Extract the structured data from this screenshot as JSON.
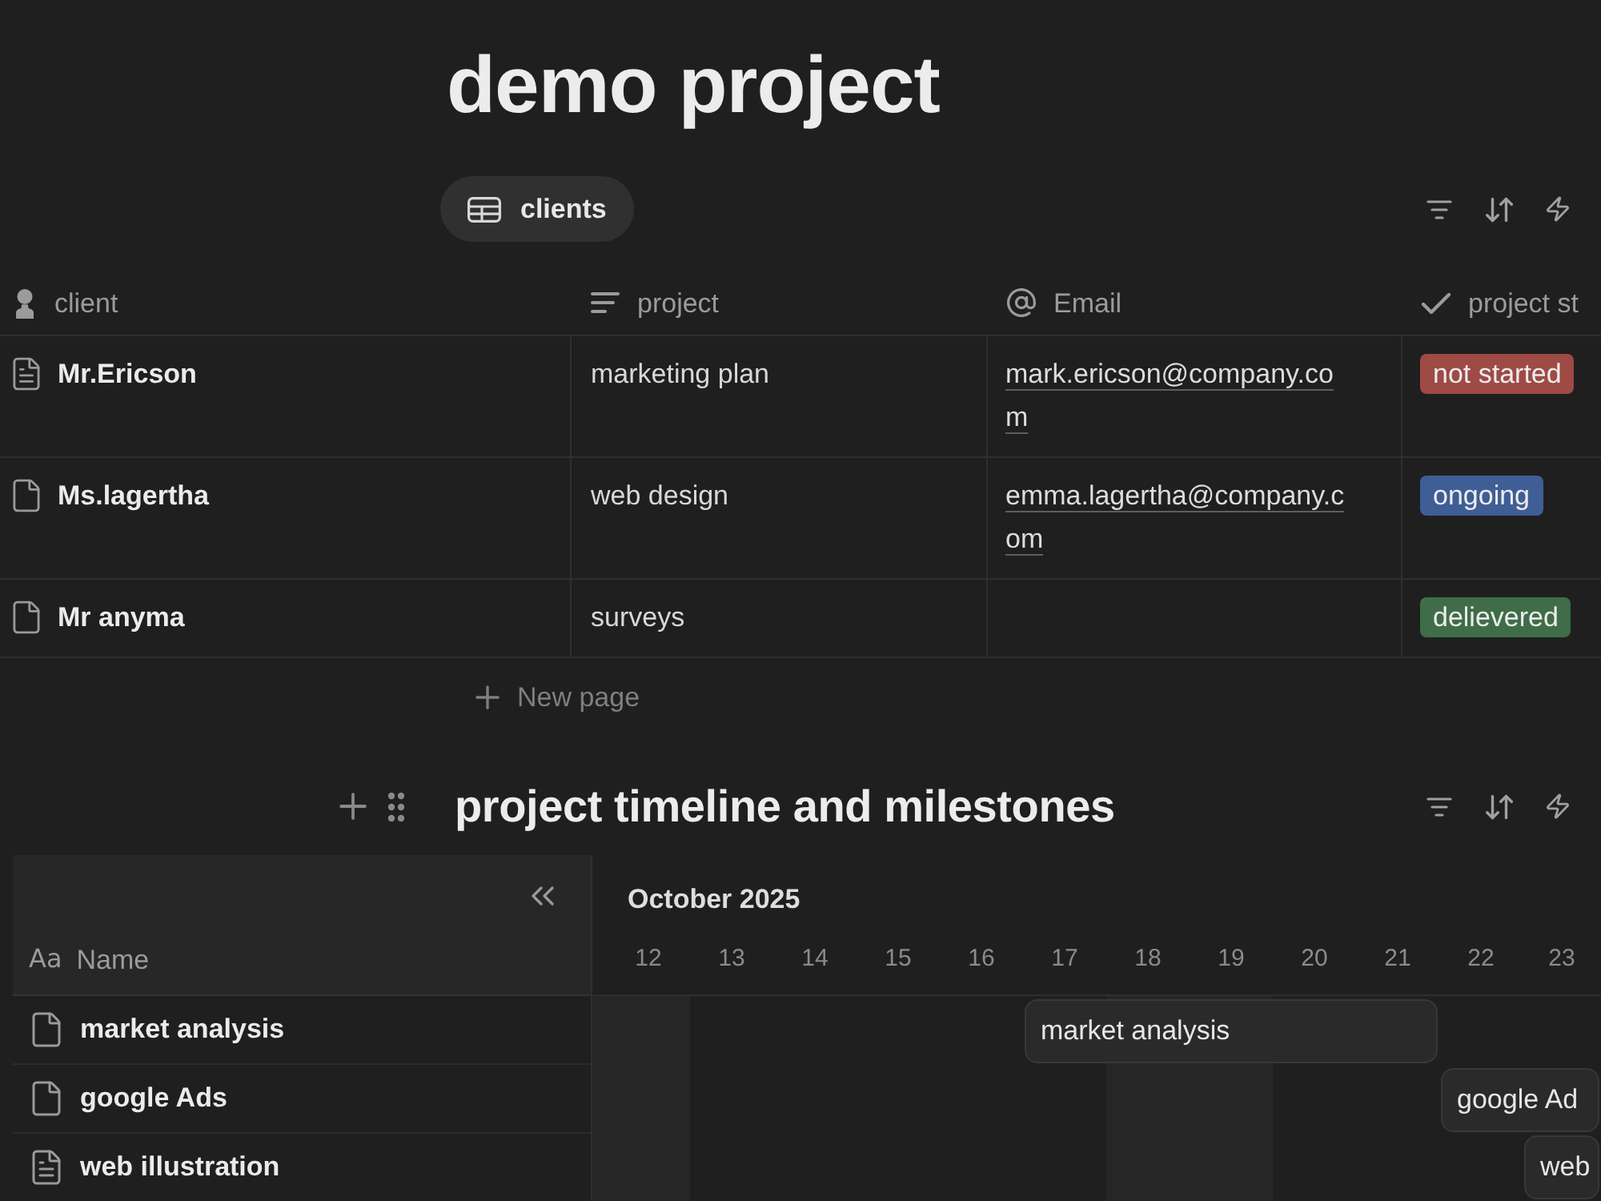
{
  "page": {
    "title": "demo project"
  },
  "clients_db": {
    "views": [
      {
        "label": "clients",
        "selected": true
      }
    ],
    "columns": [
      {
        "kind": "person",
        "label": "client"
      },
      {
        "kind": "text",
        "label": "project"
      },
      {
        "kind": "email",
        "label": "Email"
      },
      {
        "kind": "status",
        "label": "project st"
      }
    ],
    "rows": [
      {
        "kind": "document",
        "client": "Mr.Ericson",
        "project": "marketing plan",
        "email": "mark.ericson@company.com",
        "status": {
          "label": "not started",
          "color": "#9e4a45"
        }
      },
      {
        "kind": "page",
        "client": "Ms.lagertha",
        "project": "web design",
        "email": "emma.lagertha@company.com",
        "status": {
          "label": "ongoing",
          "color": "#3f5e96"
        }
      },
      {
        "kind": "page",
        "client": "Mr anyma",
        "project": "surveys",
        "status": {
          "label": "delievered",
          "color": "#3f6d48"
        }
      }
    ],
    "new_page": "New page"
  },
  "timeline": {
    "title": "project timeline and milestones",
    "name_header": {
      "type_glyph": "Aa",
      "label": "Name"
    },
    "month": "October 2025",
    "days": [
      {
        "label": "12",
        "weekend": true
      },
      {
        "label": "13",
        "weekend": false
      },
      {
        "label": "14",
        "weekend": false
      },
      {
        "label": "15",
        "weekend": false
      },
      {
        "label": "16",
        "weekend": false
      },
      {
        "label": "17",
        "weekend": false
      },
      {
        "label": "18",
        "weekend": true
      },
      {
        "label": "19",
        "weekend": true
      },
      {
        "label": "20",
        "weekend": false
      },
      {
        "label": "21",
        "weekend": false
      },
      {
        "label": "22",
        "weekend": false
      },
      {
        "label": "23",
        "weekend": false
      }
    ],
    "items": [
      {
        "kind": "page",
        "name": "market analysis",
        "bar_label": "market analysis"
      },
      {
        "kind": "page",
        "name": "google Ads",
        "bar_label": "google Ad"
      },
      {
        "kind": "document",
        "name": "web illustration",
        "bar_label": "web"
      }
    ]
  }
}
